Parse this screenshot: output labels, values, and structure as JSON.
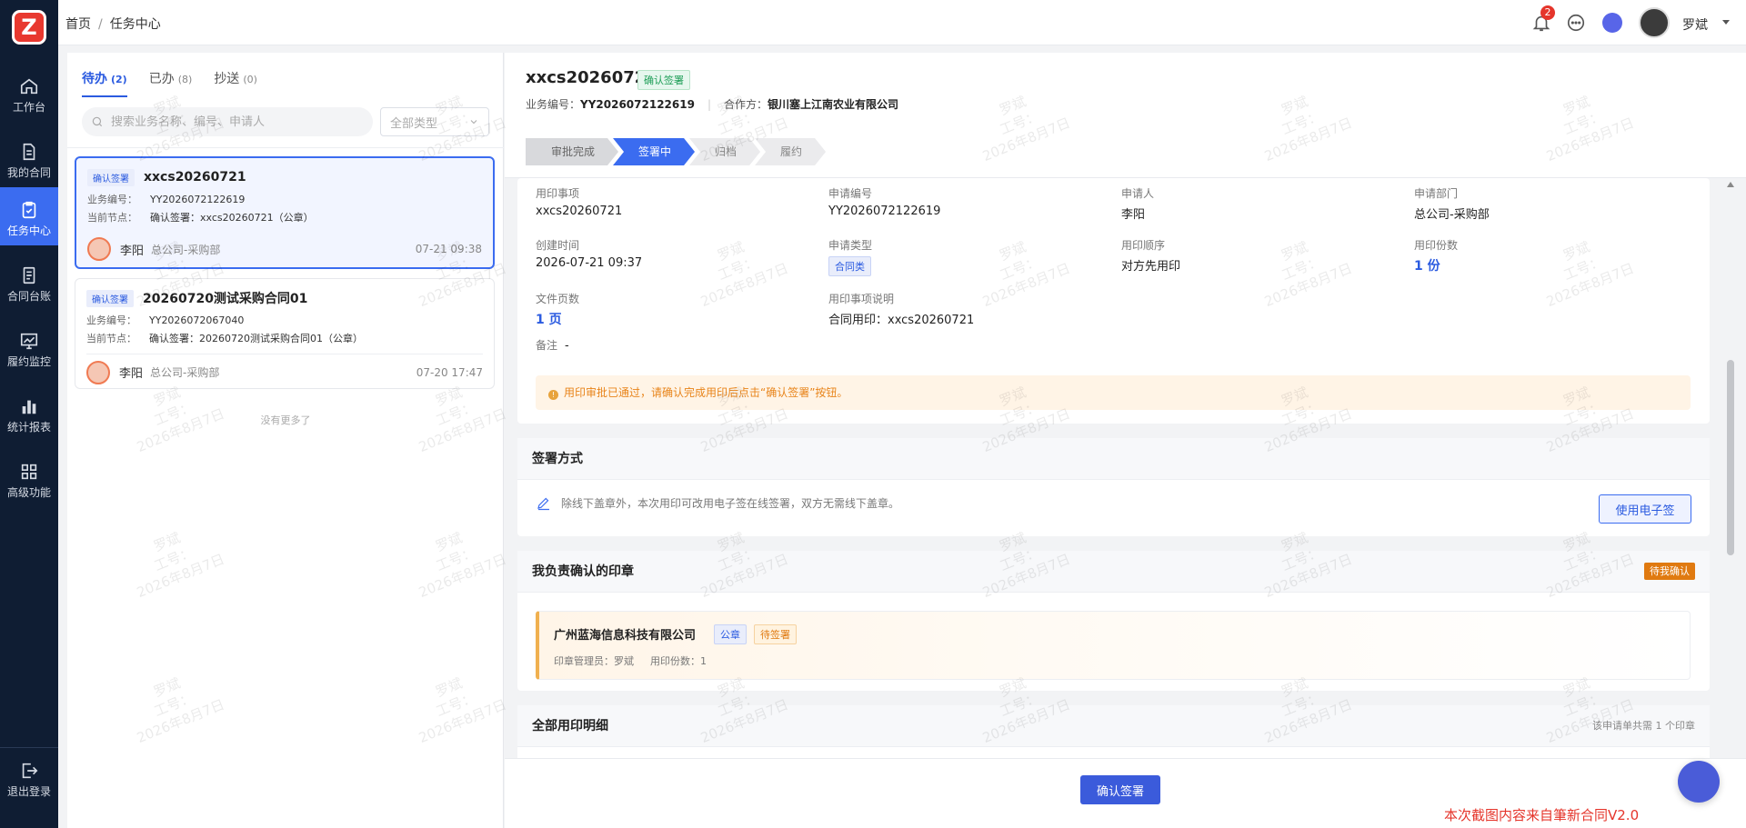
{
  "sidebar": {
    "logo": "Z",
    "items": [
      {
        "label": "工作台",
        "icon": "home-icon"
      },
      {
        "label": "我的合同",
        "icon": "document-icon"
      },
      {
        "label": "任务中心",
        "icon": "clipboard-check-icon"
      },
      {
        "label": "合同台账",
        "icon": "ledger-icon"
      },
      {
        "label": "履约监控",
        "icon": "monitor-chart-icon"
      },
      {
        "label": "统计报表",
        "icon": "bar-chart-icon"
      },
      {
        "label": "高级功能",
        "icon": "grid-icon"
      }
    ],
    "logout": "退出登录"
  },
  "topbar": {
    "breadcrumb": [
      "首页",
      "任务中心"
    ],
    "notification_count": "2",
    "user_name": "罗斌"
  },
  "list": {
    "tabs": [
      {
        "label": "待办",
        "count": "(2)"
      },
      {
        "label": "已办",
        "count": "(8)"
      },
      {
        "label": "抄送",
        "count": "(0)"
      }
    ],
    "search_placeholder": "搜索业务名称、编号、申请人",
    "type_select": "全部类型",
    "cards": [
      {
        "tag": "确认签署",
        "title": "xxcs20260721",
        "biz_label": "业务编号：",
        "biz_no": "YY2026072122619",
        "node_label": "当前节点：",
        "node": "确认签署：xxcs20260721（公章）",
        "person": "李阳",
        "dept": "总公司-采购部",
        "time": "07-21 09:38"
      },
      {
        "tag": "确认签署",
        "title": "20260720测试采购合同01",
        "biz_label": "业务编号：",
        "biz_no": "YY2026072067040",
        "node_label": "当前节点：",
        "node": "确认签署：20260720测试采购合同01（公章）",
        "person": "李阳",
        "dept": "总公司-采购部",
        "time": "07-20 17:47"
      }
    ],
    "no_more": "没有更多了"
  },
  "detail": {
    "title": "xxcs20260721",
    "status_tag": "确认签署",
    "biz_label": "业务编号：",
    "biz_no": "YY2026072122619",
    "partner_label": "合作方：",
    "partner": "银川塞上江南农业有限公司",
    "steps": [
      "审批完成",
      "签署中",
      "归档",
      "履约"
    ],
    "info": {
      "seal_item_label": "用印事项",
      "seal_item": "xxcs20260721",
      "apply_no_label": "申请编号",
      "apply_no": "YY2026072122619",
      "applicant_label": "申请人",
      "applicant": "李阳",
      "dept_label": "申请部门",
      "dept": "总公司-采购部",
      "created_label": "创建时间",
      "created": "2026-07-21 09:37",
      "type_label": "申请类型",
      "type": "合同类",
      "order_label": "用印顺序",
      "order": "对方先用印",
      "copies_label": "用印份数",
      "copies": "1 份",
      "pages_label": "文件页数",
      "pages": "1 页",
      "desc_label": "用印事项说明",
      "desc": "合同用印：xxcs20260721",
      "remark_label": "备注",
      "remark": "-",
      "notice": "用印审批已通过，请确认完成用印后点击“确认签署”按钮。"
    },
    "sign_method": {
      "title": "签署方式",
      "desc": "除线下盖章外，本次用印可改用电子签在线签署，双方无需线下盖章。",
      "button": "使用电子签"
    },
    "my_seals": {
      "title": "我负责确认的印章",
      "badge": "待我确认",
      "company": "广州蓝海信息科技有限公司",
      "seal_type": "公章",
      "seal_status": "待签署",
      "manager": "印章管理员：罗斌",
      "copies": "用印份数：1"
    },
    "all_details": {
      "title": "全部用印明细",
      "summary": "该申请单共需 1 个印章"
    },
    "confirm_button": "确认签署"
  },
  "watermark": {
    "name": "罗斌",
    "id_label": "工号：",
    "date": "2026年8月7日"
  },
  "source_note": "本次截图内容来自筆新合同V2.0"
}
